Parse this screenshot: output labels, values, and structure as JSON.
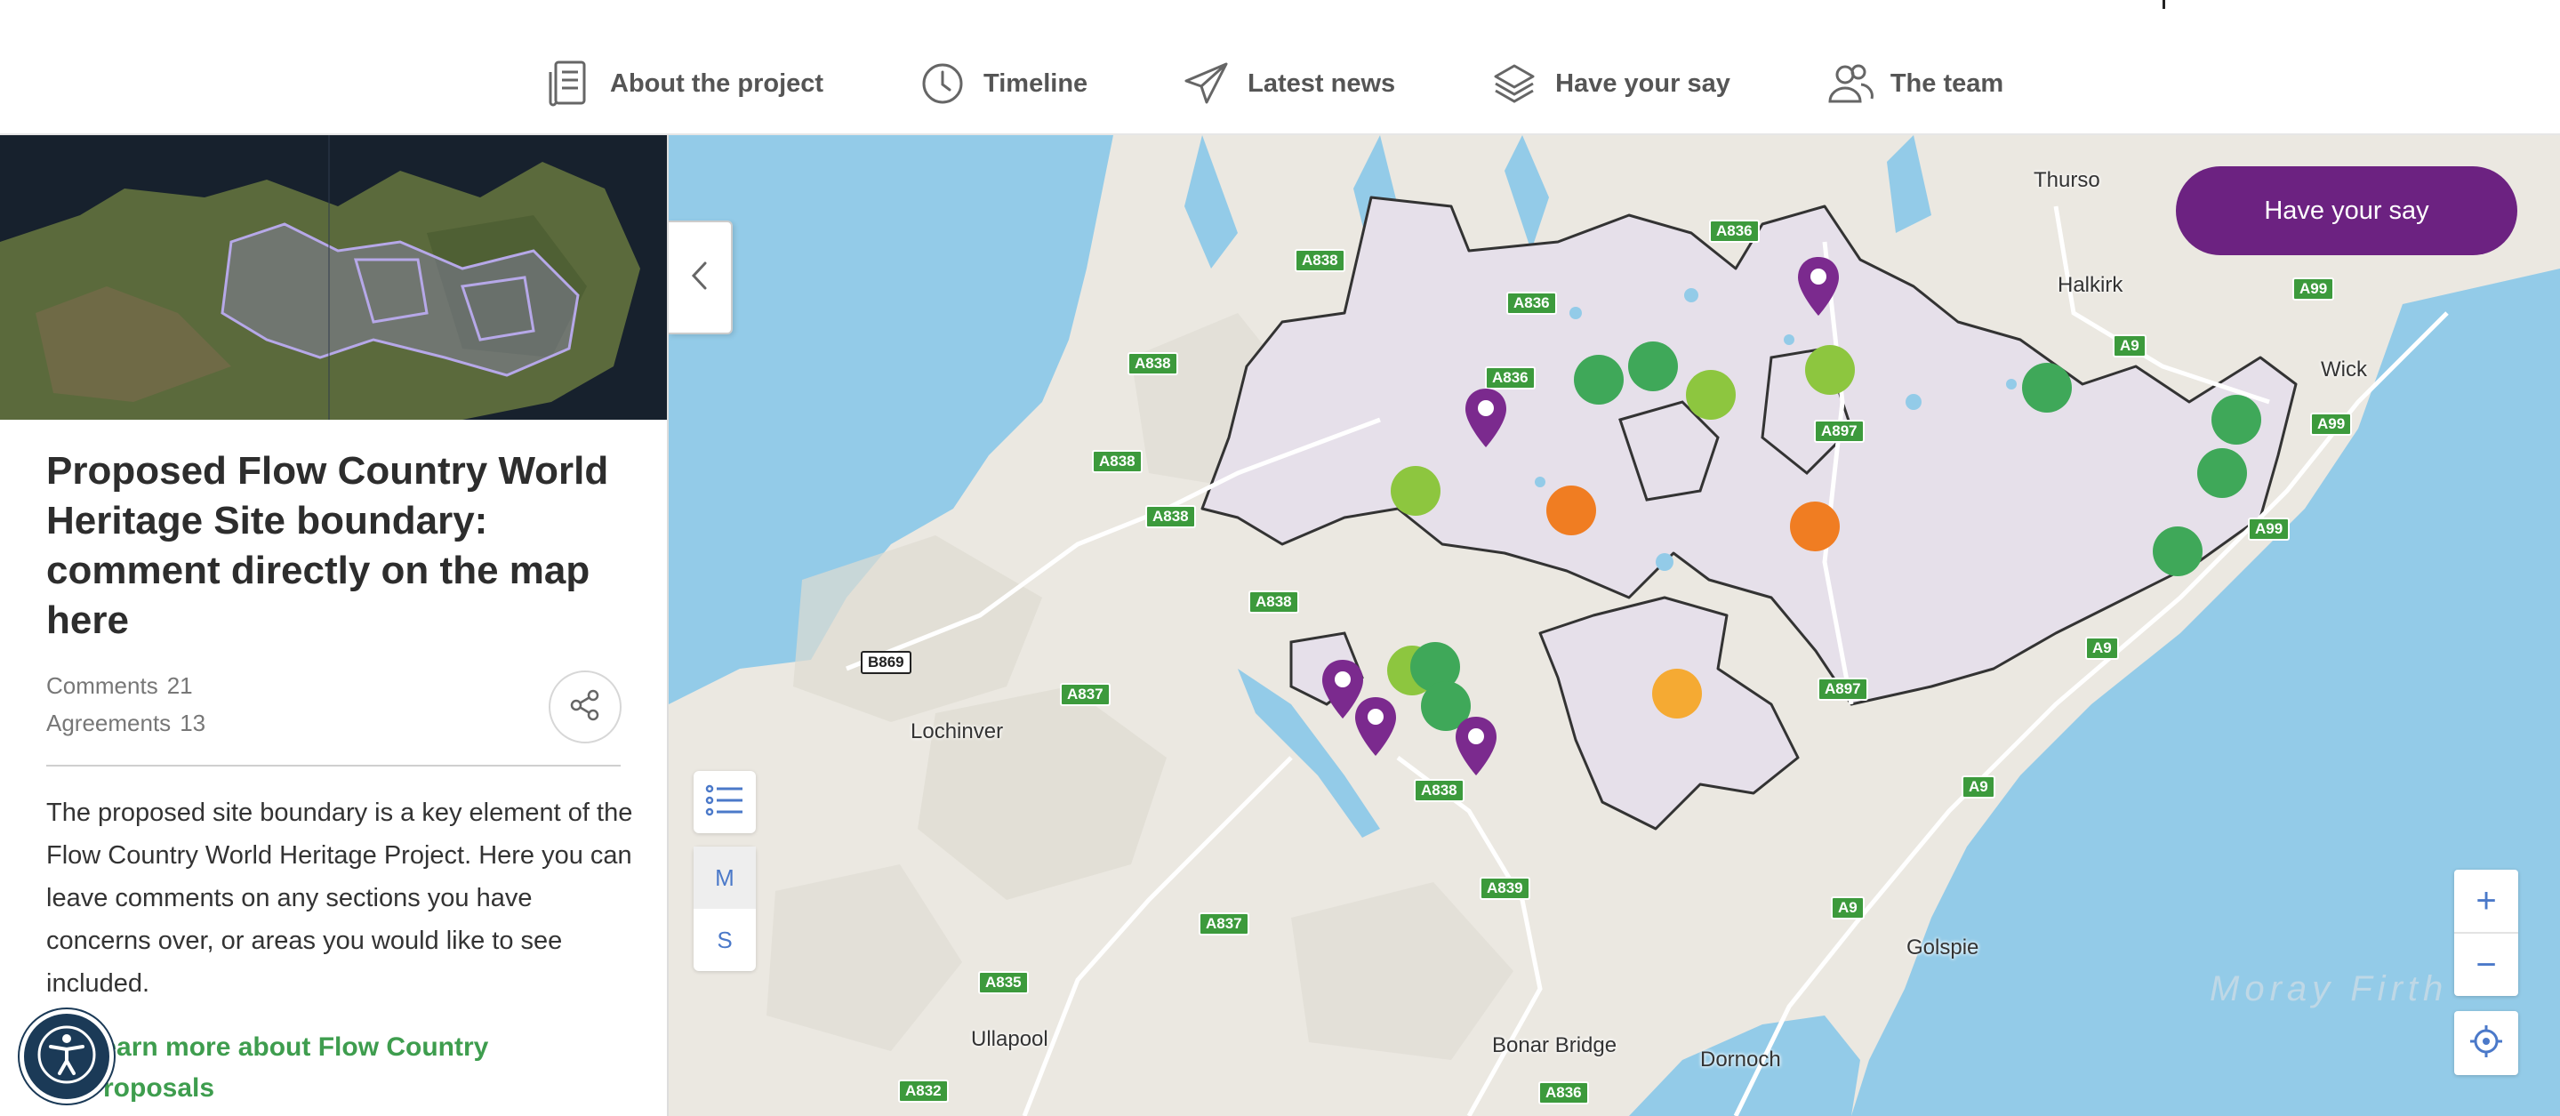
{
  "nav": {
    "items": [
      {
        "label": "About the project",
        "icon": "document-icon"
      },
      {
        "label": "Timeline",
        "icon": "clock-icon"
      },
      {
        "label": "Latest news",
        "icon": "paper-plane-icon"
      },
      {
        "label": "Have your say",
        "icon": "layers-icon"
      },
      {
        "label": "The team",
        "icon": "people-icon"
      }
    ]
  },
  "panel": {
    "title": "Proposed Flow Country World Heritage Site boundary: comment directly on the map here",
    "comments_label": "Comments",
    "comments_count": "21",
    "agreements_label": "Agreements",
    "agreements_count": "13",
    "description": "The proposed site boundary is a key element of the Flow Country World Heritage Project. Here you can leave comments on any sections you have concerns over, or areas you would like to see included.",
    "learn_more": "Learn more about Flow Country Proposals"
  },
  "map": {
    "have_your_say_button": "Have your say",
    "map_toggle": "M",
    "satellite_toggle": "S",
    "zoom_in": "+",
    "zoom_out": "−",
    "places": [
      "Thurso",
      "Halkirk",
      "Wick",
      "Lochinver",
      "Golspie",
      "Ullapool",
      "Bonar Bridge",
      "Dornoch"
    ],
    "sea_label": "Moray Firth",
    "roads": [
      "A836",
      "A838",
      "A838",
      "A836",
      "A836",
      "A838",
      "A838",
      "A838",
      "A897",
      "A9",
      "A99",
      "A99",
      "A99",
      "A9",
      "A897",
      "A837",
      "A838",
      "A839",
      "A837",
      "A835",
      "A9",
      "A9",
      "A832",
      "A836"
    ],
    "b_road": "B869",
    "colors": {
      "purple": "#7b2a8e",
      "dark_green": "#3fa859",
      "light_green": "#8dc63f",
      "orange": "#f07d22",
      "amber": "#f5aa33",
      "boundary_fill": "#e8e2ee"
    }
  }
}
